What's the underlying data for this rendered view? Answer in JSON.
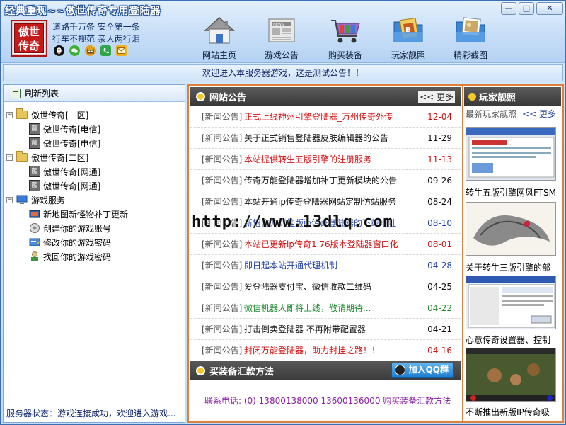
{
  "window": {
    "title": "经典重现~~傲世传奇专用登陆器"
  },
  "logo": {
    "line1": "傲世",
    "line2": "传奇"
  },
  "slogan": {
    "line1": "道路千万条  安全第一条",
    "line2": "行车不规范  亲人两行泪"
  },
  "contact_icons": [
    "qq-icon",
    "wechat-icon",
    "cat-icon",
    "phone-icon",
    "mail-icon"
  ],
  "nav": [
    {
      "label": "网站主页",
      "icon": "home-icon"
    },
    {
      "label": "游戏公告",
      "icon": "news-icon"
    },
    {
      "label": "购买装备",
      "icon": "cart-icon"
    },
    {
      "label": "玩家靓照",
      "icon": "photo-folder-icon"
    },
    {
      "label": "精彩截图",
      "icon": "screenshot-folder-icon"
    }
  ],
  "window_controls": {
    "minimize": "—",
    "maximize": "□",
    "close": "✕"
  },
  "notice": "欢迎进入本服务器游戏，这是测试公告！！",
  "left": {
    "header": "刷新列表",
    "tree": [
      {
        "label": "傲世传奇[一区]",
        "children": [
          {
            "label": "傲世传奇[电信]"
          },
          {
            "label": "傲世传奇[电信]"
          }
        ]
      },
      {
        "label": "傲世传奇[二区]",
        "children": [
          {
            "label": "傲世传奇[网通]"
          },
          {
            "label": "傲世传奇[网通]"
          }
        ]
      },
      {
        "label": "游戏服务",
        "children": [
          {
            "label": "新地图新怪物补丁更新"
          },
          {
            "label": "创建你的游戏账号"
          },
          {
            "label": "修改你的游戏密码"
          },
          {
            "label": "找回你的游戏密码"
          }
        ]
      }
    ],
    "server_icon_text": "龍",
    "status": "服务器状态：游戏连接成功，欢迎进入游戏..."
  },
  "news": {
    "title": "网站公告",
    "more": "<< 更多",
    "tag": "[新闻公告]",
    "items": [
      {
        "title": "正式上线神州引擎登陆器_万州传奇外传",
        "date": "12-04",
        "color": "#d21010"
      },
      {
        "title": "关于正式销售登陆器皮肤编辑器的公告",
        "date": "11-29",
        "color": "#111111"
      },
      {
        "title": "本站提供转生五版引擎的注册服务",
        "date": "11-13",
        "color": "#d21010"
      },
      {
        "title": "传奇万能登陆器增加补丁更新模块的公告",
        "date": "09-26",
        "color": "#111111"
      },
      {
        "title": "本站开通ip传奇登陆器网站定制仿站服务",
        "date": "08-24",
        "color": "#111111"
      },
      {
        "title": "新增官方封挂版ip传奇登陆器的下载地址",
        "date": "08-10",
        "color": "#1f3fa6"
      },
      {
        "title": "本站已更新ip传奇1.76版本登陆器窗口化",
        "date": "08-01",
        "color": "#d21010"
      },
      {
        "title": "即日起本站开通代理机制",
        "date": "04-28",
        "color": "#1f3fa6"
      },
      {
        "title": "爱登陆器支付宝、微信收款二维码",
        "date": "04-25",
        "color": "#111111"
      },
      {
        "title": "微信机器人即将上线，敬请期待...",
        "date": "04-22",
        "color": "#1f8a2e"
      },
      {
        "title": "打击倒卖登陆器 不再附带配置器",
        "date": "04-21",
        "color": "#111111"
      },
      {
        "title": "封闭万能登陆器，助力封挂之路！！",
        "date": "04-16",
        "color": "#d21010"
      }
    ]
  },
  "pay": {
    "title": "买装备汇款方法",
    "qq_button": "加入QQ群",
    "text": "联系电话: (0) 13800138000 13600136000 购买装备汇款方法"
  },
  "right": {
    "title": "玩家靓照",
    "sub": "最新玩家靓照",
    "more": "<< 更多",
    "items": [
      {
        "caption": "转生五版引擎网风FTSM"
      },
      {
        "caption": "关于转生三版引擎的部"
      },
      {
        "caption": "心意传奇设置器、控制"
      },
      {
        "caption": "不断推出新版IP传奇吸"
      }
    ]
  },
  "watermark": "http://www.13dlq.com"
}
